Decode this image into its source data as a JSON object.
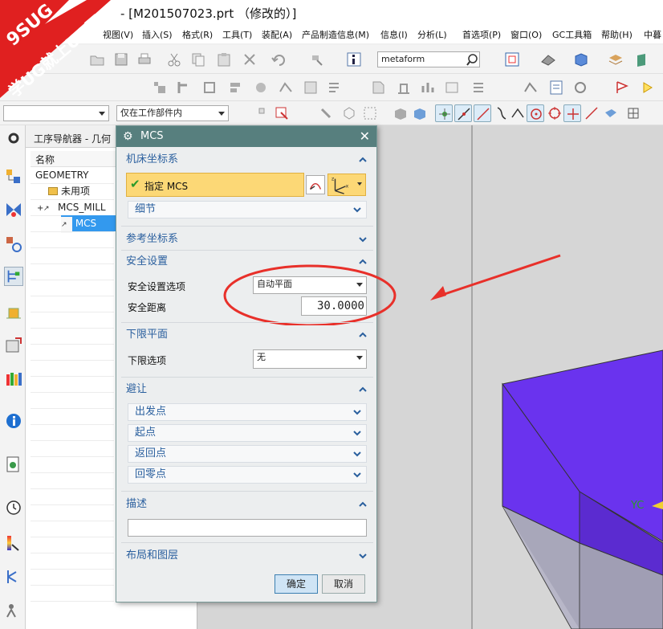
{
  "window": {
    "title": "- [M201507023.prt （修改的）]"
  },
  "logo": {
    "line1": "9SUG",
    "line2": "学UG就上UG网"
  },
  "menu": [
    "视图(V)",
    "插入(S)",
    "格式(R)",
    "工具(T)",
    "装配(A)",
    "产品制造信息(M)",
    "信息(I)",
    "分析(L)",
    "首选项(P)",
    "窗口(O)",
    "GC工具箱",
    "帮助(H)",
    "中暮"
  ],
  "toolbar": {
    "search_value": "metaform",
    "filter_value": "仅在工作部件内",
    "type_filter_value": ""
  },
  "navigator": {
    "title": "工序导航器 - 几何",
    "column_name": "名称",
    "items": [
      {
        "label": "GEOMETRY"
      },
      {
        "label": "未用项"
      },
      {
        "label": "MCS_MILL"
      },
      {
        "label": "MCS"
      }
    ]
  },
  "dialog": {
    "title": "MCS",
    "sections": {
      "machine_cs": "机床坐标系",
      "specify_mcs": "指定 MCS",
      "details": "细节",
      "reference_cs": "参考坐标系",
      "safety": "安全设置",
      "safety_option_label": "安全设置选项",
      "safety_option_value": "自动平面",
      "safety_distance_label": "安全距离",
      "safety_distance_value": "30.0000",
      "lower_limit": "下限平面",
      "lower_limit_label": "下限选项",
      "lower_limit_value": "无",
      "avoidance": "避让",
      "from_point": "出发点",
      "start_point": "起点",
      "return_point": "返回点",
      "home_point": "回零点",
      "description": "描述",
      "description_value": "",
      "layout_layers": "布局和图层"
    },
    "ok_label": "确定",
    "cancel_label": "取消"
  },
  "viewport": {
    "axis_label": "YC"
  },
  "colors": {
    "dialog_title": "#577f7e",
    "section_text": "#2a5f9e",
    "highlight": "#fcd876",
    "model_top": "#6a33ee",
    "annotation": "#e8302a"
  }
}
